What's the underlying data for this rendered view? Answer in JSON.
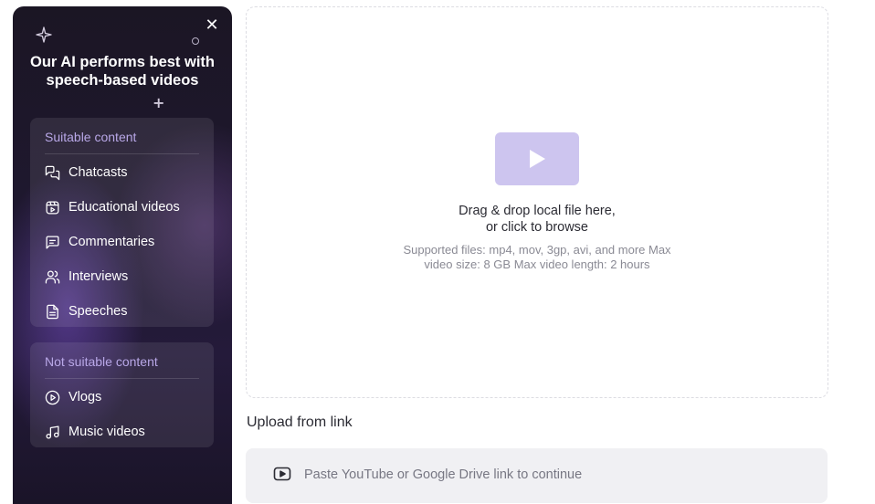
{
  "panel": {
    "close_label": "✕",
    "title_line1": "Our AI performs best with",
    "title_line2": "speech-based videos",
    "suitable": {
      "heading": "Suitable content",
      "items": [
        {
          "label": "Chatcasts",
          "icon": "chat-bubbles-icon"
        },
        {
          "label": "Educational videos",
          "icon": "video-lesson-icon"
        },
        {
          "label": "Commentaries",
          "icon": "comment-icon"
        },
        {
          "label": "Interviews",
          "icon": "people-icon"
        },
        {
          "label": "Speeches",
          "icon": "document-icon"
        }
      ]
    },
    "not_suitable": {
      "heading": "Not suitable content",
      "items": [
        {
          "label": "Vlogs",
          "icon": "play-circle-icon"
        },
        {
          "label": "Music videos",
          "icon": "music-note-icon"
        }
      ]
    }
  },
  "dropzone": {
    "title_line1": "Drag & drop local file here,",
    "title_line2": "or click to browse",
    "sub_line1": "Supported files: mp4, mov, 3gp, avi, and more Max",
    "sub_line2": "video size: 8 GB Max video length: 2 hours"
  },
  "link": {
    "heading": "Upload from link",
    "placeholder": "Paste YouTube or Google Drive link to continue"
  },
  "colors": {
    "accent": "#b9a8e8",
    "play_tile": "#cdc5ef",
    "panel_bg": "#1f1830"
  }
}
